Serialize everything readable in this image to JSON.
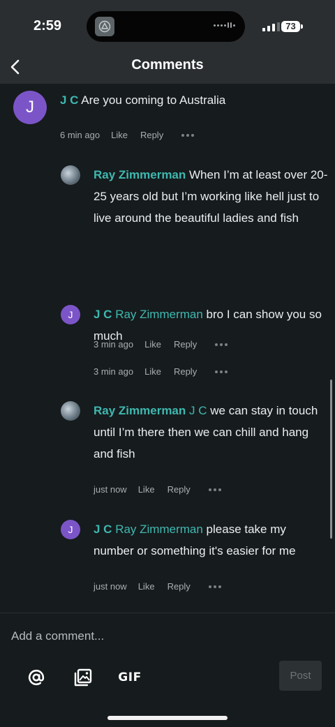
{
  "status_bar": {
    "time": "2:59",
    "battery": "73"
  },
  "header": {
    "title": "Comments",
    "back_icon": "chevron-left-icon"
  },
  "comments": [
    {
      "avatar_letter": "J",
      "author": "J C",
      "mention": "",
      "body": " Are you coming to Australia",
      "time": "6 min ago",
      "like": "Like",
      "reply": "Reply"
    },
    {
      "avatar_letter": "",
      "author": "Ray Zimmerman",
      "mention": "",
      "body": " When I’m at least over 20-25 years old but I’m working like hell just to live around the beautiful ladies and fish",
      "time": "3 min ago",
      "like": "Like",
      "reply": "Reply"
    },
    {
      "avatar_letter": "J",
      "author": "J C",
      "mention": " Ray Zimmerman",
      "body": " bro I can show you so much",
      "time": "3 min ago",
      "like": "Like",
      "reply": "Reply"
    },
    {
      "avatar_letter": "",
      "author": "Ray Zimmerman",
      "mention": " J C",
      "body": " we can stay in touch until I’m there then we can chill and hang and fish",
      "time": "just now",
      "like": "Like",
      "reply": "Reply"
    },
    {
      "avatar_letter": "J",
      "author": "J C",
      "mention": " Ray Zimmerman",
      "body": " please take my number or something it's easier for me",
      "time": "just now",
      "like": "Like",
      "reply": "Reply"
    }
  ],
  "composer": {
    "placeholder": "Add a comment...",
    "mention_icon": "at-sign-icon",
    "image_icon": "image-icon",
    "gif_label": "GIF",
    "post_label": "Post"
  },
  "colors": {
    "background": "#161b1d",
    "bar": "#2a2e30",
    "accent": "#3fb8b0",
    "avatar": "#7b55c7"
  }
}
